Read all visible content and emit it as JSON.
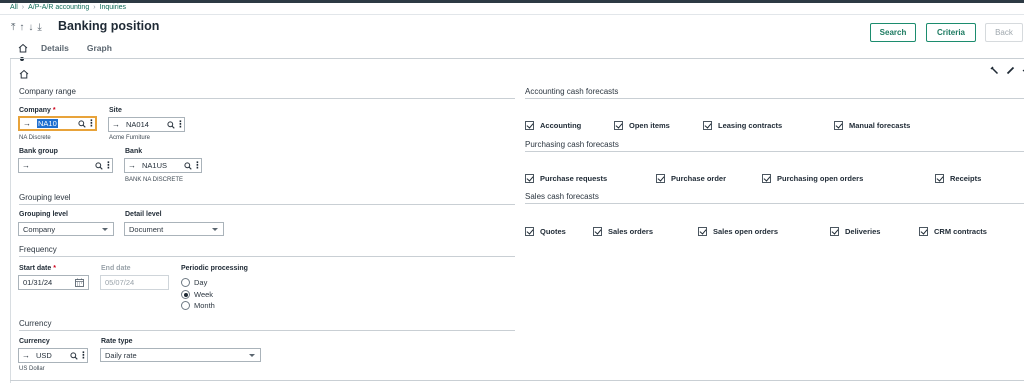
{
  "breadcrumb": [
    "All",
    "A/P-A/R accounting",
    "Inquiries"
  ],
  "header": {
    "title": "Banking position",
    "buttons": {
      "search": "Search",
      "criteria": "Criteria",
      "back": "Back"
    }
  },
  "tabs": [
    "Details",
    "Graph"
  ],
  "company_range": {
    "title": "Company range",
    "company": {
      "label": "Company",
      "value": "NA10",
      "description": "NA Discrete"
    },
    "site": {
      "label": "Site",
      "value": "NA014",
      "description": "Acme Furniture"
    },
    "bank_group": {
      "label": "Bank group",
      "value": ""
    },
    "bank": {
      "label": "Bank",
      "value": "NA1US",
      "description": "BANK NA DISCRETE"
    }
  },
  "grouping": {
    "title": "Grouping level",
    "grouping_level": {
      "label": "Grouping level",
      "value": "Company"
    },
    "detail_level": {
      "label": "Detail level",
      "value": "Document"
    }
  },
  "frequency": {
    "title": "Frequency",
    "start_date": {
      "label": "Start date",
      "value": "01/31/24"
    },
    "end_date": {
      "label": "End date",
      "value": "05/07/24"
    },
    "periodic": {
      "label": "Periodic processing",
      "options": [
        "Day",
        "Week",
        "Month"
      ],
      "selected": "Week"
    }
  },
  "currency_section": {
    "title": "Currency",
    "currency": {
      "label": "Currency",
      "value": "USD",
      "description": "US Dollar"
    },
    "rate_type": {
      "label": "Rate type",
      "value": "Daily rate"
    }
  },
  "accounting_forecasts": {
    "title": "Accounting cash forecasts",
    "items": [
      "Accounting",
      "Open items",
      "Leasing contracts",
      "Manual forecasts"
    ]
  },
  "purchasing_forecasts": {
    "title": "Purchasing cash forecasts",
    "items": [
      "Purchase requests",
      "Purchase order",
      "Purchasing open orders",
      "Receipts"
    ]
  },
  "sales_forecasts": {
    "title": "Sales cash forecasts",
    "items": [
      "Quotes",
      "Sales orders",
      "Sales open orders",
      "Deliveries",
      "CRM contracts"
    ]
  },
  "required_mark": "*",
  "icons": [
    "home-icon",
    "search-icon",
    "more-icon",
    "calendar-icon",
    "wrench-icon",
    "pencil-icon"
  ]
}
